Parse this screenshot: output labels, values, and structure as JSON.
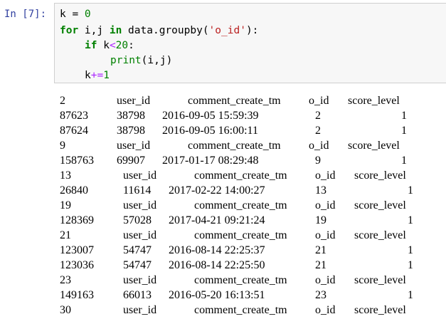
{
  "cell": {
    "prompt": "In [7]:",
    "code": {
      "line1": {
        "a": "k = ",
        "b": "0"
      },
      "line2": {
        "for": "for",
        "vars": " i,j ",
        "in": "in",
        "call": " data.groupby(",
        "str": "'o_id'",
        "close": "):"
      },
      "line3": {
        "if": "if",
        "k": " k",
        "lt": "<",
        "num": "20",
        "colon": ":"
      },
      "line4": {
        "print": "print",
        "args": "(i,j)"
      },
      "line5": {
        "k": "k",
        "op": "+=",
        "num": "1"
      }
    }
  },
  "output": {
    "lines": [
      {
        "kind": "header",
        "c0": "2",
        "c1": "user_id",
        "c2": "comment_create_tm",
        "c3": "o_id",
        "c4": "score_level"
      },
      {
        "kind": "row",
        "c0": "87623",
        "c1": "38798",
        "c2": "2016-09-05 15:59:39",
        "c3": "2",
        "c4": "1"
      },
      {
        "kind": "row",
        "c0": "87624",
        "c1": "38798",
        "c2": "2016-09-05 16:00:11",
        "c3": "2",
        "c4": "1"
      },
      {
        "kind": "header",
        "c0": "9",
        "c1": "user_id",
        "c2": "comment_create_tm",
        "c3": "o_id",
        "c4": "score_level"
      },
      {
        "kind": "row",
        "c0": "158763",
        "c1": "69907",
        "c2": "2017-01-17 08:29:48",
        "c3": "9",
        "c4": "1"
      },
      {
        "kind": "header",
        "c0": "13",
        "c1": "user_id",
        "c2": "comment_create_tm",
        "c3": "o_id",
        "c4": "score_level"
      },
      {
        "kind": "row",
        "c0": "26840",
        "c1": "11614",
        "c2": "2017-02-22 14:00:27",
        "c3": "13",
        "c4": "1"
      },
      {
        "kind": "header",
        "c0": "19",
        "c1": "user_id",
        "c2": "comment_create_tm",
        "c3": "o_id",
        "c4": "score_level"
      },
      {
        "kind": "row",
        "c0": "128369",
        "c1": "57028",
        "c2": "2017-04-21 09:21:24",
        "c3": "19",
        "c4": "1"
      },
      {
        "kind": "header",
        "c0": "21",
        "c1": "user_id",
        "c2": "comment_create_tm",
        "c3": "o_id",
        "c4": "score_level"
      },
      {
        "kind": "row",
        "c0": "123007",
        "c1": "54747",
        "c2": "2016-08-14 22:25:37",
        "c3": "21",
        "c4": "1"
      },
      {
        "kind": "row",
        "c0": "123036",
        "c1": "54747",
        "c2": "2016-08-14 22:25:50",
        "c3": "21",
        "c4": "1"
      },
      {
        "kind": "header",
        "c0": "23",
        "c1": "user_id",
        "c2": "comment_create_tm",
        "c3": "o_id",
        "c4": "score_level"
      },
      {
        "kind": "row",
        "c0": "149163",
        "c1": "66013",
        "c2": "2016-05-20 16:13:51",
        "c3": "23",
        "c4": "1"
      },
      {
        "kind": "header",
        "c0": "30",
        "c1": "user_id",
        "c2": "comment_create_tm",
        "c3": "o_id",
        "c4": "score_level"
      }
    ]
  }
}
